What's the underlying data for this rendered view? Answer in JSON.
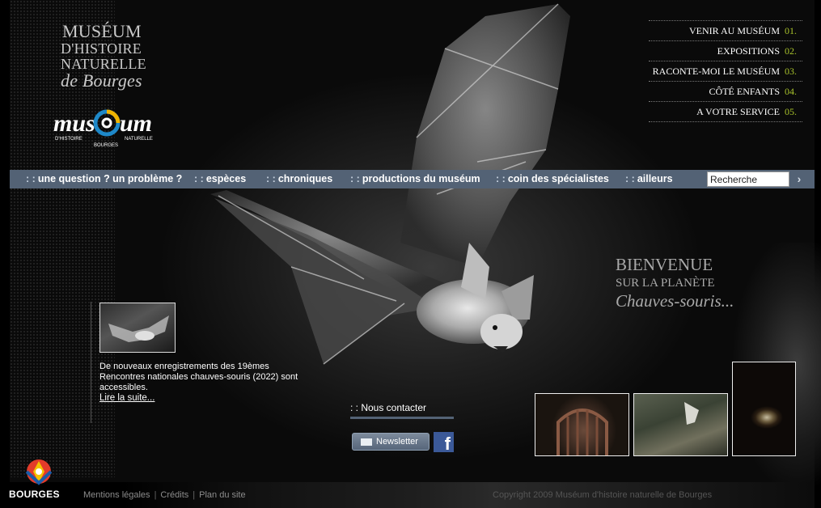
{
  "logo": {
    "line1": "MUSÉUM",
    "line2": "D'HISTOIRE",
    "line3": "NATURELLE",
    "line4": "de Bourges",
    "emblem_word": "mus um",
    "emblem_sub_left": "D'HISTOIRE",
    "emblem_sub_right": "NATURELLE",
    "emblem_sub_bottom": "BOURGES"
  },
  "top_menu": [
    {
      "label": "VENIR AU MUSÉUM",
      "num": "01."
    },
    {
      "label": "EXPOSITIONS",
      "num": "02."
    },
    {
      "label": "RACONTE-MOI LE MUSÉUM",
      "num": "03."
    },
    {
      "label": "CÔTÉ ENFANTS",
      "num": "04."
    },
    {
      "label": "A VOTRE SERVICE",
      "num": "05."
    }
  ],
  "nav": {
    "sep": ": :",
    "items": [
      "une question ? un problème ?",
      "espèces",
      "chroniques",
      "productions du muséum",
      "coin des spécialistes",
      "ailleurs"
    ],
    "search_value": "Recherche",
    "search_button": "›"
  },
  "welcome": {
    "line1": "BIENVENUE",
    "line2": "SUR LA PLANÈTE",
    "line3": "Chauves-souris..."
  },
  "news": {
    "text": "De nouveaux enregistrements des 19èmes Rencontres nationales chauves-souris (2022) sont accessibles.",
    "more": "Lire la suite..."
  },
  "contact": {
    "title": ": : Nous contacter",
    "newsletter": "Newsletter",
    "facebook": "f"
  },
  "footer": {
    "city": "BOURGES",
    "links": [
      "Mentions légales",
      "Crédits",
      "Plan du site"
    ],
    "copyright": "Copyright 2009 Muséum d'histoire naturelle de Bourges"
  },
  "colors": {
    "navbar": "#536275",
    "accent_green": "#a7c12b"
  }
}
